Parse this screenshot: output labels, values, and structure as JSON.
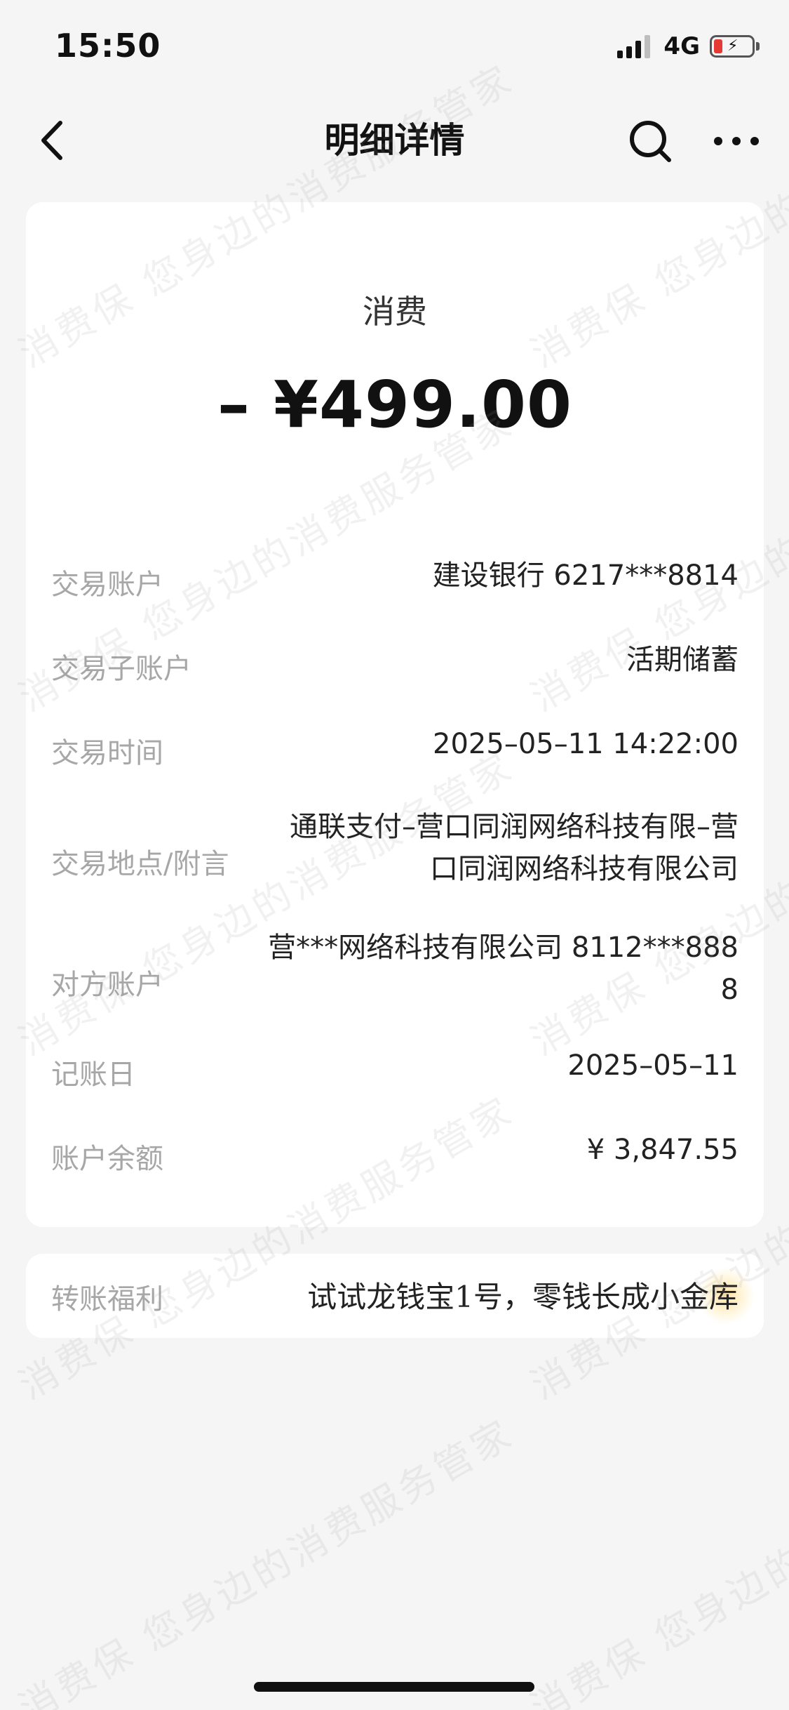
{
  "status_bar": {
    "time": "15:50",
    "network": "4G",
    "battery_icon": "battery-charging-low-icon",
    "signal_icon": "signal-bars-icon"
  },
  "nav": {
    "title": "明细详情",
    "back_icon": "chevron-left-icon",
    "search_icon": "search-icon",
    "more_icon": "more-horizontal-icon"
  },
  "transaction": {
    "type": "消费",
    "amount": "– ¥499.00"
  },
  "details": [
    {
      "label": "交易账户",
      "value": "建设银行 6217***8814"
    },
    {
      "label": "交易子账户",
      "value": "活期储蓄"
    },
    {
      "label": "交易时间",
      "value": "2025–05–11 14:22:00"
    },
    {
      "label": "交易地点/附言",
      "value_lines": [
        "通联支付–营口同润网络科技有限–营",
        "口同润网络科技有限公司"
      ]
    },
    {
      "label": "对方账户",
      "value_lines": [
        "营***网络科技有限公司 8112***888",
        "8"
      ]
    },
    {
      "label": "记账日",
      "value": "2025–05–11"
    },
    {
      "label": "账户余额",
      "value": "¥ 3,847.55"
    }
  ],
  "benefit": {
    "label": "转账福利",
    "link_text": "试试龙钱宝1号，零钱长成小金库"
  },
  "watermark": {
    "text": "消费保 您身边的消费服务管家"
  },
  "colors": {
    "background": "#f5f5f5",
    "card": "#ffffff",
    "label": "#a7a7a7",
    "value": "#222222",
    "battery_low": "#e53935"
  }
}
